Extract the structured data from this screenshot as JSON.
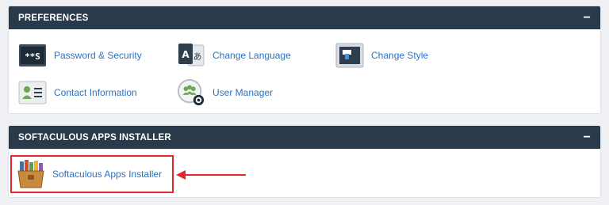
{
  "preferences": {
    "title": "PREFERENCES",
    "collapse_symbol": "−",
    "items": [
      {
        "label": "Password & Security",
        "icon": "password-icon"
      },
      {
        "label": "Change Language",
        "icon": "language-icon"
      },
      {
        "label": "Change Style",
        "icon": "style-icon"
      },
      {
        "label": "Contact Information",
        "icon": "contact-icon"
      },
      {
        "label": "User Manager",
        "icon": "user-manager-icon"
      }
    ]
  },
  "softaculous": {
    "title": "SOFTACULOUS APPS INSTALLER",
    "collapse_symbol": "−",
    "items": [
      {
        "label": "Softaculous Apps Installer",
        "icon": "softaculous-icon"
      }
    ]
  },
  "password_icon_text": "**S",
  "language_icon_text_a": "A",
  "language_icon_text_b": "あ",
  "colors": {
    "header_bg": "#293a4a",
    "link": "#2a72c4",
    "annotation_red": "#e2262c",
    "page_bg": "#eef0f3"
  }
}
